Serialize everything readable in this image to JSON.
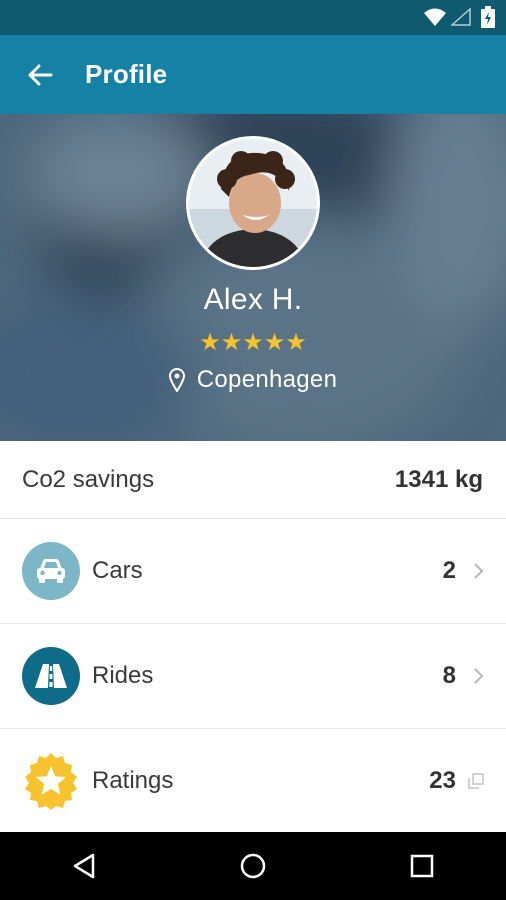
{
  "colors": {
    "status_bar": "#0e5a6e",
    "app_bar": "#1581a4",
    "star": "#f6c22d",
    "cars_icon_bg": "#7db6c7",
    "rides_icon_bg": "#0f6c88",
    "ratings_icon_bg": "#f6c22d"
  },
  "app_bar": {
    "title": "Profile",
    "back_icon": "arrow-left-icon"
  },
  "profile": {
    "name": "Alex H.",
    "rating_stars": "★★★★★",
    "rating": 5,
    "location": "Copenhagen"
  },
  "stats": {
    "co2_label": "Co2 savings",
    "co2_value": "1341 kg"
  },
  "items": [
    {
      "label": "Cars",
      "value": "2",
      "icon": "car-icon",
      "trailing": "chevron-right-icon"
    },
    {
      "label": "Rides",
      "value": "8",
      "icon": "road-icon",
      "trailing": "chevron-right-icon"
    },
    {
      "label": "Ratings",
      "value": "23",
      "icon": "star-badge-icon",
      "trailing": "external-icon"
    }
  ],
  "nav": [
    "back-nav-icon",
    "home-nav-icon",
    "recents-nav-icon"
  ]
}
